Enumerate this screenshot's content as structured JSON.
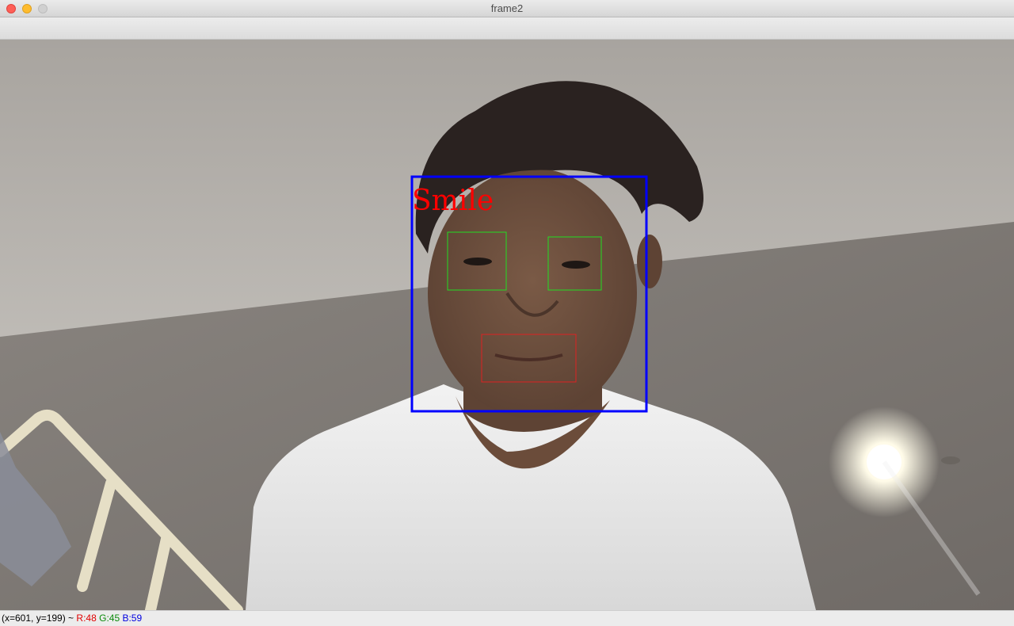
{
  "window": {
    "title": "frame2"
  },
  "overlay": {
    "label": "Smile",
    "face_box_color": "#0000ff",
    "eye_box_color": "#22dd22",
    "mouth_box_color": "#dd2222",
    "label_color": "#ff0000"
  },
  "status": {
    "coords": "(x=601, y=199) ~",
    "r": "R:48",
    "g": "G:45",
    "b": "B:59",
    "r_color": "#e00000",
    "g_color": "#0a8a0a",
    "b_color": "#0000e0"
  },
  "icons": {
    "close": "close-icon",
    "minimize": "minimize-icon",
    "maximize": "maximize-icon"
  }
}
